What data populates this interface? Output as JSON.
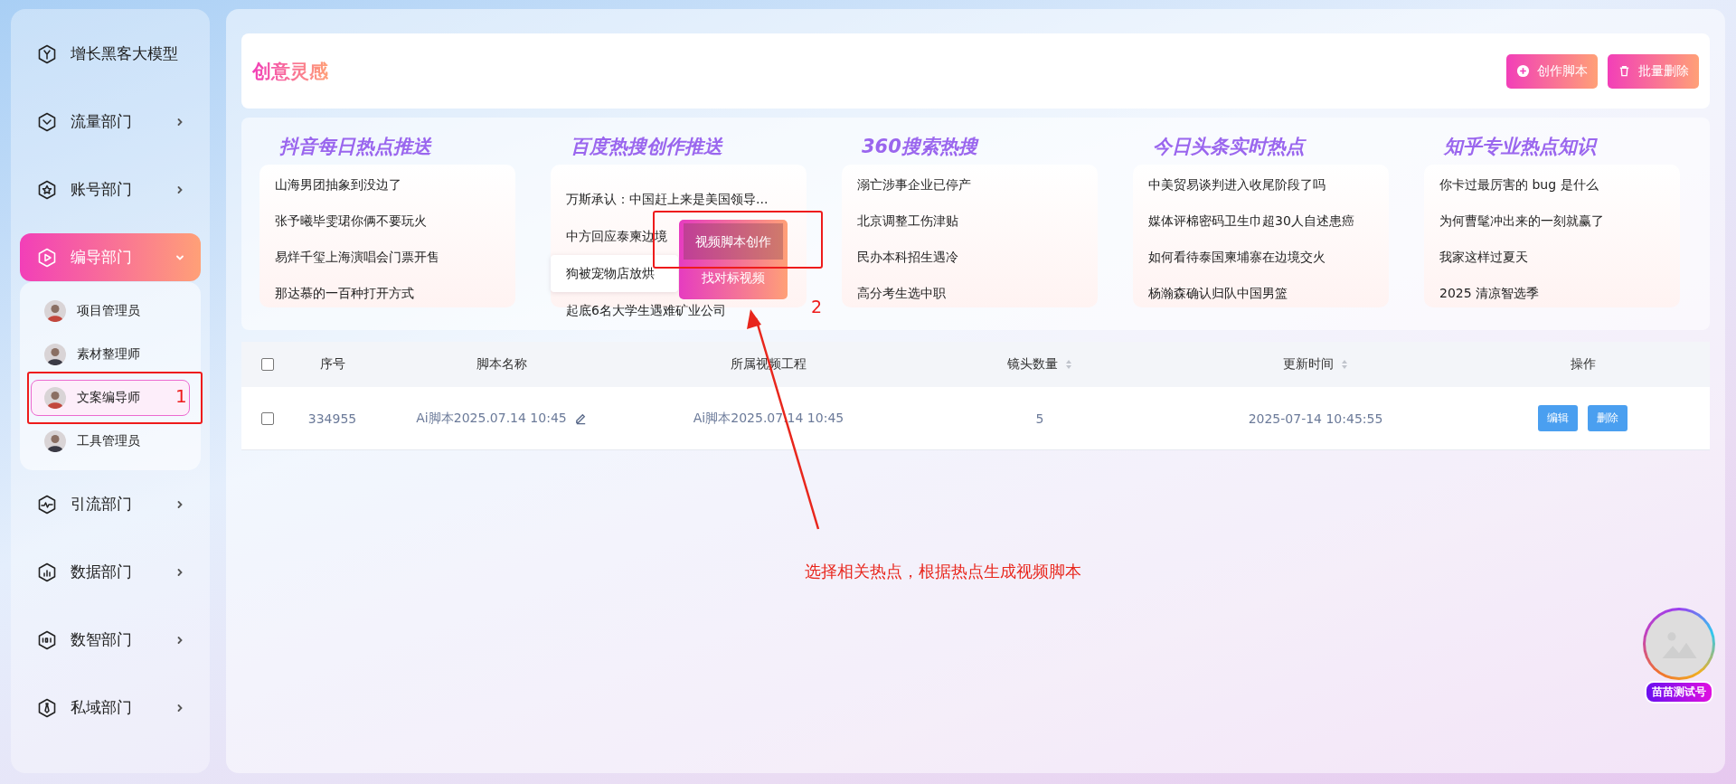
{
  "sidebar": {
    "items": [
      {
        "label": "增长黑客大模型",
        "selected": false
      },
      {
        "label": "流量部门",
        "selected": false,
        "expanded": false
      },
      {
        "label": "账号部门",
        "selected": false,
        "expanded": false
      },
      {
        "label": "编导部门",
        "selected": true,
        "expanded": true,
        "children": [
          {
            "label": "项目管理员",
            "selected": false
          },
          {
            "label": "素材整理师",
            "selected": false
          },
          {
            "label": "文案编导师",
            "selected": true
          },
          {
            "label": "工具管理员",
            "selected": false
          }
        ]
      },
      {
        "label": "引流部门",
        "selected": false,
        "expanded": false
      },
      {
        "label": "数据部门",
        "selected": false,
        "expanded": false
      },
      {
        "label": "数智部门",
        "selected": false,
        "expanded": false
      },
      {
        "label": "私域部门",
        "selected": false,
        "expanded": false
      }
    ]
  },
  "header": {
    "title": "创意灵感",
    "buttons": [
      {
        "label": "创作脚本",
        "kind": "create"
      },
      {
        "label": "批量删除",
        "kind": "delete"
      }
    ]
  },
  "hot_topics": [
    {
      "title": "抖音每日热点推送",
      "items": [
        {
          "text": "山海男团抽象到没边了",
          "hovered": false
        },
        {
          "text": "张予曦毕雯珺你俩不要玩火",
          "hovered": false
        },
        {
          "text": "易烊千玺上海演唱会门票开售",
          "hovered": false
        },
        {
          "text": "那达慕的一百种打开方式",
          "hovered": false
        }
      ]
    },
    {
      "title": "百度热搜创作推送",
      "items": [
        {
          "text": "万斯承认：中国赶上来是美国领导...",
          "hovered": false
        },
        {
          "text": "中方回应泰柬边境",
          "hovered": false
        },
        {
          "text": "狗被宠物店放烘",
          "hovered": true
        },
        {
          "text": "起底6名大学生遇难矿业公司",
          "hovered": false
        }
      ],
      "menu": [
        {
          "label": "视频脚本创作",
          "selected": true
        },
        {
          "label": "找对标视频",
          "selected": false
        }
      ]
    },
    {
      "title": "360搜索热搜",
      "items": [
        {
          "text": "溺亡涉事企业已停产",
          "hovered": false
        },
        {
          "text": "北京调整工伤津贴",
          "hovered": false
        },
        {
          "text": "民办本科招生遇冷",
          "hovered": false
        },
        {
          "text": "高分考生选中职",
          "hovered": false
        }
      ]
    },
    {
      "title": "今日头条实时热点",
      "items": [
        {
          "text": "中美贸易谈判进入收尾阶段了吗",
          "hovered": false
        },
        {
          "text": "媒体评棉密码卫生巾超30人自述患癌",
          "hovered": false
        },
        {
          "text": "如何看待泰国柬埔寨在边境交火",
          "hovered": false
        },
        {
          "text": "杨瀚森确认归队中国男篮",
          "hovered": false
        }
      ]
    },
    {
      "title": "知乎专业热点知识",
      "items": [
        {
          "text": "你卡过最厉害的 bug 是什么",
          "hovered": false
        },
        {
          "text": "为何曹髦冲出来的一刻就赢了",
          "hovered": false
        },
        {
          "text": "我家这样过夏天",
          "hovered": false
        },
        {
          "text": "2025 清凉智选季",
          "hovered": false
        }
      ]
    }
  ],
  "table": {
    "all_checked": false,
    "columns": [
      {
        "label": "序号",
        "sortable": false
      },
      {
        "label": "脚本名称",
        "sortable": false
      },
      {
        "label": "所属视频工程",
        "sortable": false
      },
      {
        "label": "镜头数量",
        "sortable": true
      },
      {
        "label": "更新时间",
        "sortable": true
      },
      {
        "label": "操作",
        "sortable": false
      }
    ],
    "rows": [
      {
        "checked": false,
        "id": "334955",
        "name": "Ai脚本2025.07.14 10:45",
        "project": "Ai脚本2025.07.14 10:45",
        "shots": "5",
        "updated": "2025-07-14 10:45:55",
        "actions": [
          "编辑",
          "删除"
        ]
      }
    ]
  },
  "annotations": {
    "markers": [
      "1",
      "2"
    ],
    "caption": "选择相关热点，根据热点生成视频脚本"
  },
  "profile": {
    "name": "苗苗测试号"
  }
}
